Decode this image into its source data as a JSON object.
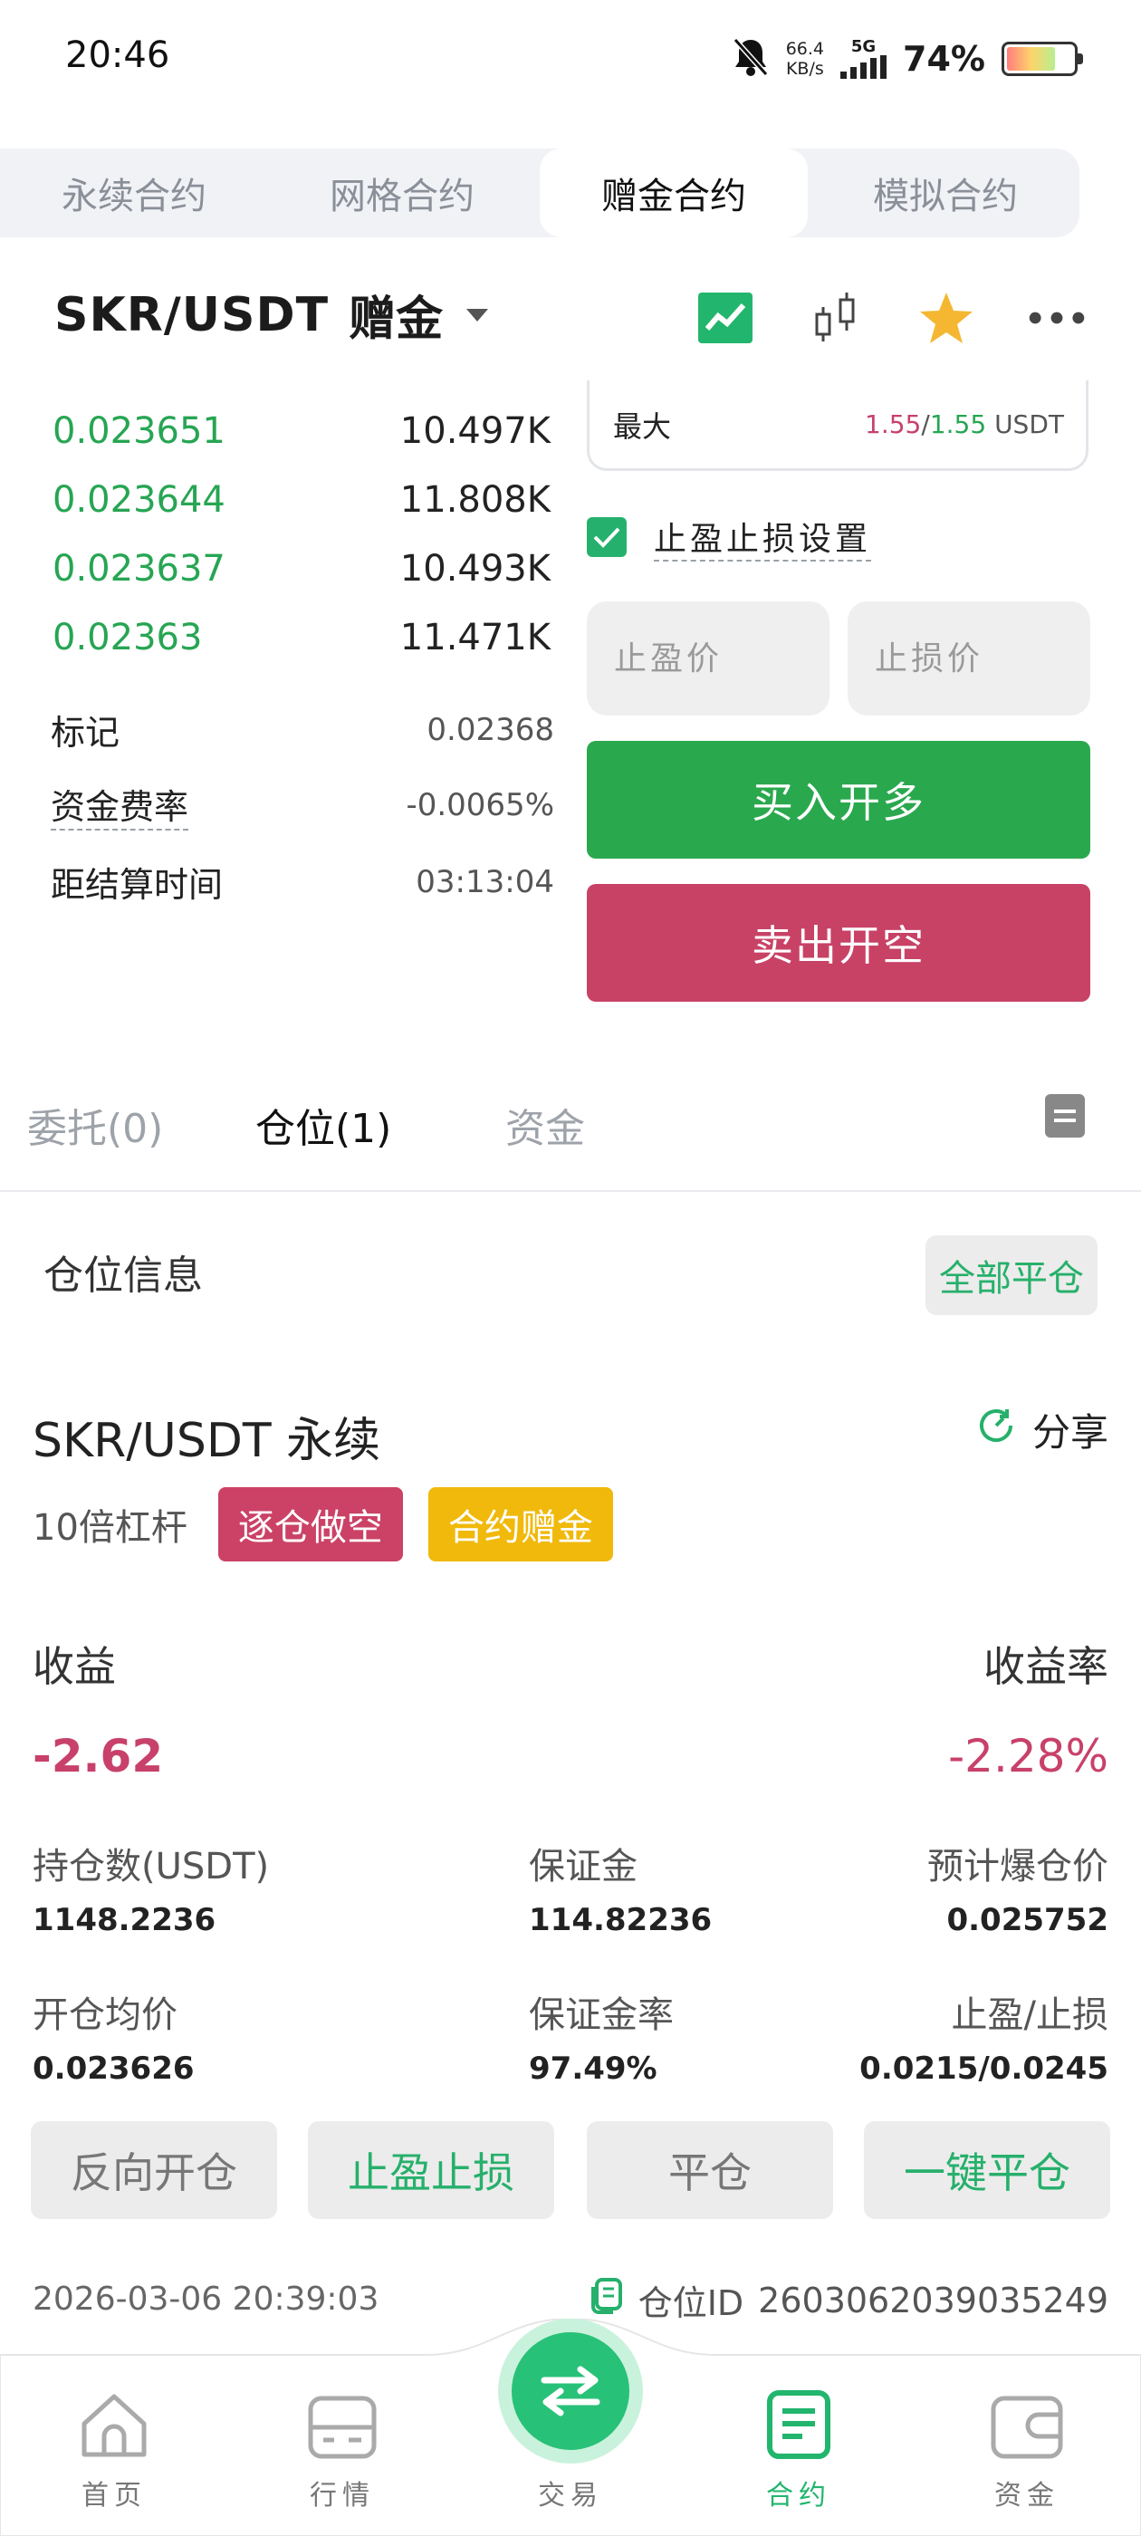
{
  "status": {
    "time": "20:46",
    "net_speed": "66.4",
    "net_unit": "KB/s",
    "signal": "5G",
    "battery": "74%",
    "battery_level": 0.74
  },
  "top_tabs": [
    "永续合约",
    "网格合约",
    "赠金合约",
    "模拟合约"
  ],
  "header": {
    "pair": "SKR/USDT",
    "type": "赠金"
  },
  "order_book": [
    {
      "price": "0.023651",
      "qty": "10.497K",
      "depth": 0.98
    },
    {
      "price": "0.023644",
      "qty": "11.808K",
      "depth": 1.0
    },
    {
      "price": "0.023637",
      "qty": "10.493K",
      "depth": 0.98
    },
    {
      "price": "0.02363",
      "qty": "11.471K",
      "depth": 0.99
    }
  ],
  "market_info": {
    "mark_label": "标记",
    "mark_value": "0.02368",
    "funding_label": "资金费率",
    "funding_value": "-0.0065%",
    "settle_label": "距结算时间",
    "settle_value": "03:13:04"
  },
  "order_form": {
    "max_label": "最大",
    "max_value_a": "1.55",
    "max_sep": "/",
    "max_value_b": "1.55",
    "max_unit": "USDT",
    "tpsl_label": "止盈止损设置",
    "tp_placeholder": "止盈价",
    "sl_placeholder": "止损价",
    "buy_label": "买入开多",
    "sell_label": "卖出开空"
  },
  "section_tabs": {
    "orders": "委托(0)",
    "positions": "仓位(1)",
    "funds": "资金"
  },
  "position": {
    "title": "仓位信息",
    "close_all": "全部平仓",
    "pair": "SKR/USDT 永续",
    "share": "分享",
    "leverage": "10倍杠杆",
    "badge_side": "逐仓做空",
    "badge_bonus": "合约赠金",
    "pnl_label": "收益",
    "pnl_rate_label": "收益率",
    "pnl_value": "-2.62",
    "pnl_rate_value": "-2.28%",
    "size_label": "持仓数(USDT)",
    "size_value": "1148.2236",
    "margin_label": "保证金",
    "margin_value": "114.82236",
    "liq_label": "预计爆仓价",
    "liq_value": "0.025752",
    "entry_label": "开仓均价",
    "entry_value": "0.023626",
    "margin_rate_label": "保证金率",
    "margin_rate_value": "97.49%",
    "tpsl_label": "止盈/止损",
    "tpsl_value": "0.0215/0.0245",
    "btn_reverse": "反向开仓",
    "btn_tpsl": "止盈止损",
    "btn_close": "平仓",
    "btn_quick_close": "一键平仓",
    "time": "2026-03-06 20:39:03",
    "id_label": "仓位ID",
    "id_value": "2603062039035249"
  },
  "nav": {
    "home": "首页",
    "market": "行情",
    "trade": "交易",
    "contract": "合约",
    "assets": "资金"
  },
  "colors": {
    "green": "#27a553",
    "red": "#c8416a",
    "accent": "#26b06b",
    "yellow": "#f0b90b"
  }
}
